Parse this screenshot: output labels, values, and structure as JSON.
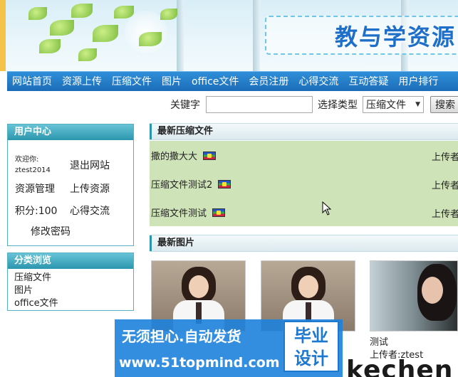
{
  "banner": {
    "title": "教与学资源"
  },
  "nav": {
    "items": [
      "网站首页",
      "资源上传",
      "压缩文件",
      "图片",
      "office文件",
      "会员注册",
      "心得交流",
      "互动答疑",
      "用户排行"
    ]
  },
  "search": {
    "keyword_label": "关键字",
    "keyword_value": "",
    "type_label": "选择类型",
    "type_selected": "压缩文件",
    "search_button": "搜索"
  },
  "user_center": {
    "title": "用户中心",
    "welcome": "欢迎你:",
    "username": "ztest2014",
    "logout": "退出网站",
    "manage": "资源管理",
    "upload": "上传资源",
    "points": "积分:100",
    "exchange": "心得交流",
    "change_password": "修改密码"
  },
  "categories": {
    "title": "分类浏览",
    "items": [
      "压缩文件",
      "图片",
      "office文件"
    ]
  },
  "latest_zip": {
    "title": "最新压缩文件",
    "items": [
      {
        "name": "撒的撒大大",
        "uploader": "上传者"
      },
      {
        "name": "压缩文件测试2",
        "uploader": "上传者"
      },
      {
        "name": "压缩文件测试",
        "uploader": "上传者"
      }
    ]
  },
  "latest_images": {
    "title": "最新图片",
    "third_caption": "测试",
    "third_uploader": "上传者:ztest"
  },
  "watermark": {
    "line1": "无须担心.自动发货",
    "line2": "www.51topmind.com",
    "box_line1": "毕业",
    "box_line2": "设计",
    "side_text": "kechen"
  },
  "colors": {
    "nav": "#1c6cb8",
    "panel_header": "#2a96ae",
    "zip_bg": "#cfe3b9",
    "watermark": "#1e82dc"
  }
}
